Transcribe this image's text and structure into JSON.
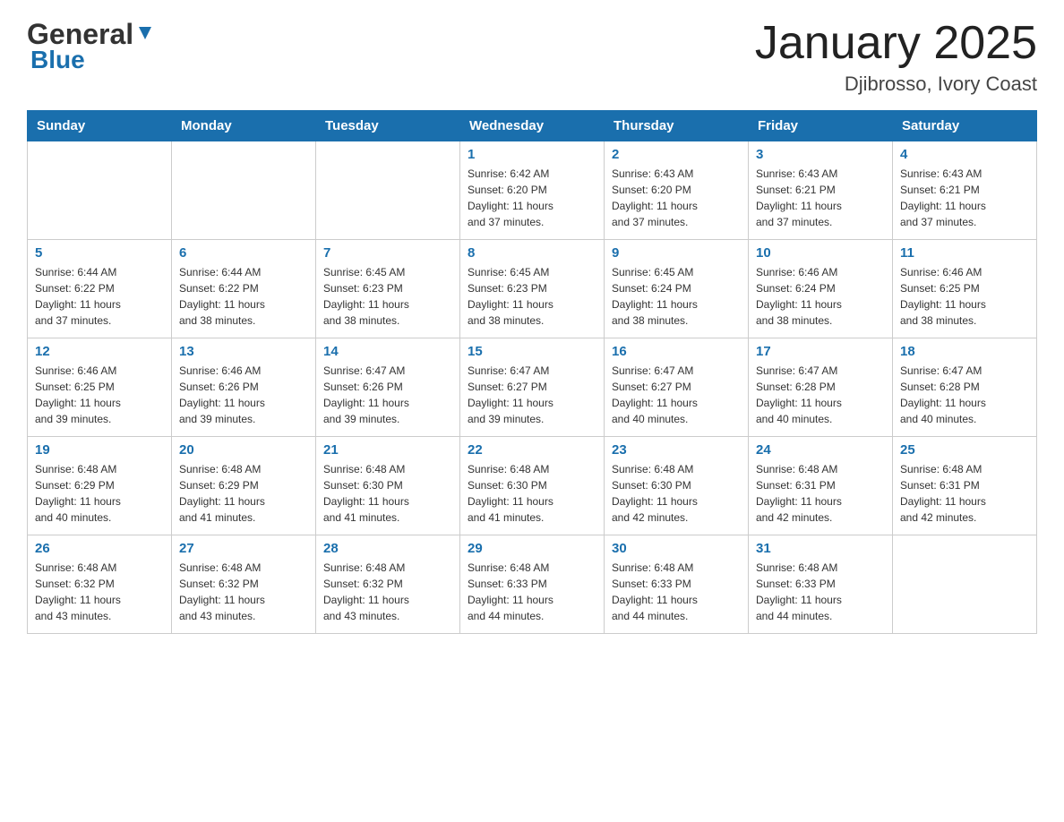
{
  "header": {
    "logo_general": "General",
    "logo_blue": "Blue",
    "title": "January 2025",
    "location": "Djibrosso, Ivory Coast"
  },
  "weekdays": [
    "Sunday",
    "Monday",
    "Tuesday",
    "Wednesday",
    "Thursday",
    "Friday",
    "Saturday"
  ],
  "weeks": [
    [
      {
        "day": "",
        "info": ""
      },
      {
        "day": "",
        "info": ""
      },
      {
        "day": "",
        "info": ""
      },
      {
        "day": "1",
        "info": "Sunrise: 6:42 AM\nSunset: 6:20 PM\nDaylight: 11 hours\nand 37 minutes."
      },
      {
        "day": "2",
        "info": "Sunrise: 6:43 AM\nSunset: 6:20 PM\nDaylight: 11 hours\nand 37 minutes."
      },
      {
        "day": "3",
        "info": "Sunrise: 6:43 AM\nSunset: 6:21 PM\nDaylight: 11 hours\nand 37 minutes."
      },
      {
        "day": "4",
        "info": "Sunrise: 6:43 AM\nSunset: 6:21 PM\nDaylight: 11 hours\nand 37 minutes."
      }
    ],
    [
      {
        "day": "5",
        "info": "Sunrise: 6:44 AM\nSunset: 6:22 PM\nDaylight: 11 hours\nand 37 minutes."
      },
      {
        "day": "6",
        "info": "Sunrise: 6:44 AM\nSunset: 6:22 PM\nDaylight: 11 hours\nand 38 minutes."
      },
      {
        "day": "7",
        "info": "Sunrise: 6:45 AM\nSunset: 6:23 PM\nDaylight: 11 hours\nand 38 minutes."
      },
      {
        "day": "8",
        "info": "Sunrise: 6:45 AM\nSunset: 6:23 PM\nDaylight: 11 hours\nand 38 minutes."
      },
      {
        "day": "9",
        "info": "Sunrise: 6:45 AM\nSunset: 6:24 PM\nDaylight: 11 hours\nand 38 minutes."
      },
      {
        "day": "10",
        "info": "Sunrise: 6:46 AM\nSunset: 6:24 PM\nDaylight: 11 hours\nand 38 minutes."
      },
      {
        "day": "11",
        "info": "Sunrise: 6:46 AM\nSunset: 6:25 PM\nDaylight: 11 hours\nand 38 minutes."
      }
    ],
    [
      {
        "day": "12",
        "info": "Sunrise: 6:46 AM\nSunset: 6:25 PM\nDaylight: 11 hours\nand 39 minutes."
      },
      {
        "day": "13",
        "info": "Sunrise: 6:46 AM\nSunset: 6:26 PM\nDaylight: 11 hours\nand 39 minutes."
      },
      {
        "day": "14",
        "info": "Sunrise: 6:47 AM\nSunset: 6:26 PM\nDaylight: 11 hours\nand 39 minutes."
      },
      {
        "day": "15",
        "info": "Sunrise: 6:47 AM\nSunset: 6:27 PM\nDaylight: 11 hours\nand 39 minutes."
      },
      {
        "day": "16",
        "info": "Sunrise: 6:47 AM\nSunset: 6:27 PM\nDaylight: 11 hours\nand 40 minutes."
      },
      {
        "day": "17",
        "info": "Sunrise: 6:47 AM\nSunset: 6:28 PM\nDaylight: 11 hours\nand 40 minutes."
      },
      {
        "day": "18",
        "info": "Sunrise: 6:47 AM\nSunset: 6:28 PM\nDaylight: 11 hours\nand 40 minutes."
      }
    ],
    [
      {
        "day": "19",
        "info": "Sunrise: 6:48 AM\nSunset: 6:29 PM\nDaylight: 11 hours\nand 40 minutes."
      },
      {
        "day": "20",
        "info": "Sunrise: 6:48 AM\nSunset: 6:29 PM\nDaylight: 11 hours\nand 41 minutes."
      },
      {
        "day": "21",
        "info": "Sunrise: 6:48 AM\nSunset: 6:30 PM\nDaylight: 11 hours\nand 41 minutes."
      },
      {
        "day": "22",
        "info": "Sunrise: 6:48 AM\nSunset: 6:30 PM\nDaylight: 11 hours\nand 41 minutes."
      },
      {
        "day": "23",
        "info": "Sunrise: 6:48 AM\nSunset: 6:30 PM\nDaylight: 11 hours\nand 42 minutes."
      },
      {
        "day": "24",
        "info": "Sunrise: 6:48 AM\nSunset: 6:31 PM\nDaylight: 11 hours\nand 42 minutes."
      },
      {
        "day": "25",
        "info": "Sunrise: 6:48 AM\nSunset: 6:31 PM\nDaylight: 11 hours\nand 42 minutes."
      }
    ],
    [
      {
        "day": "26",
        "info": "Sunrise: 6:48 AM\nSunset: 6:32 PM\nDaylight: 11 hours\nand 43 minutes."
      },
      {
        "day": "27",
        "info": "Sunrise: 6:48 AM\nSunset: 6:32 PM\nDaylight: 11 hours\nand 43 minutes."
      },
      {
        "day": "28",
        "info": "Sunrise: 6:48 AM\nSunset: 6:32 PM\nDaylight: 11 hours\nand 43 minutes."
      },
      {
        "day": "29",
        "info": "Sunrise: 6:48 AM\nSunset: 6:33 PM\nDaylight: 11 hours\nand 44 minutes."
      },
      {
        "day": "30",
        "info": "Sunrise: 6:48 AM\nSunset: 6:33 PM\nDaylight: 11 hours\nand 44 minutes."
      },
      {
        "day": "31",
        "info": "Sunrise: 6:48 AM\nSunset: 6:33 PM\nDaylight: 11 hours\nand 44 minutes."
      },
      {
        "day": "",
        "info": ""
      }
    ]
  ]
}
